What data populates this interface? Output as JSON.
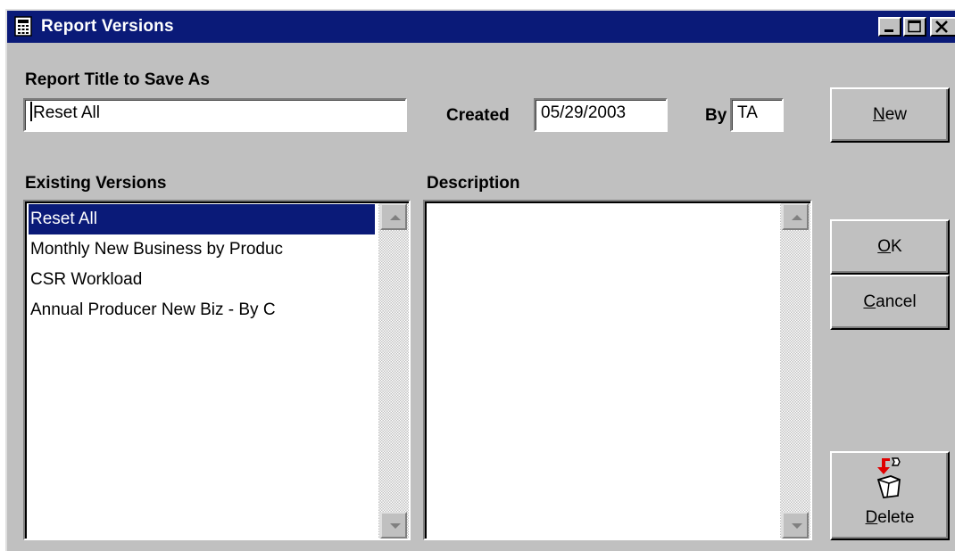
{
  "window": {
    "title": "Report Versions"
  },
  "report_title": {
    "label": "Report Title to Save As",
    "value": "Reset All"
  },
  "created": {
    "label": "Created",
    "value": "05/29/2003"
  },
  "by": {
    "label": "By",
    "value": "TA"
  },
  "existing_versions": {
    "label": "Existing Versions",
    "items": [
      {
        "text": "Reset All",
        "selected": true
      },
      {
        "text": "Monthly New Business by Produc",
        "selected": false
      },
      {
        "text": "CSR Workload",
        "selected": false
      },
      {
        "text": "Annual Producer New Biz - By C",
        "selected": false
      }
    ]
  },
  "description": {
    "label": "Description",
    "value": ""
  },
  "buttons": {
    "new": {
      "mnemonic": "N",
      "rest": "ew"
    },
    "ok": {
      "mnemonic": "O",
      "rest": "K"
    },
    "cancel": {
      "mnemonic": "C",
      "rest": "ancel"
    },
    "delete": {
      "mnemonic": "D",
      "rest": "elete",
      "icon": "trash-icon"
    }
  },
  "colors": {
    "titlebar": "#0a1a78",
    "selection": "#0a1a78",
    "face": "#c0c0c0"
  }
}
